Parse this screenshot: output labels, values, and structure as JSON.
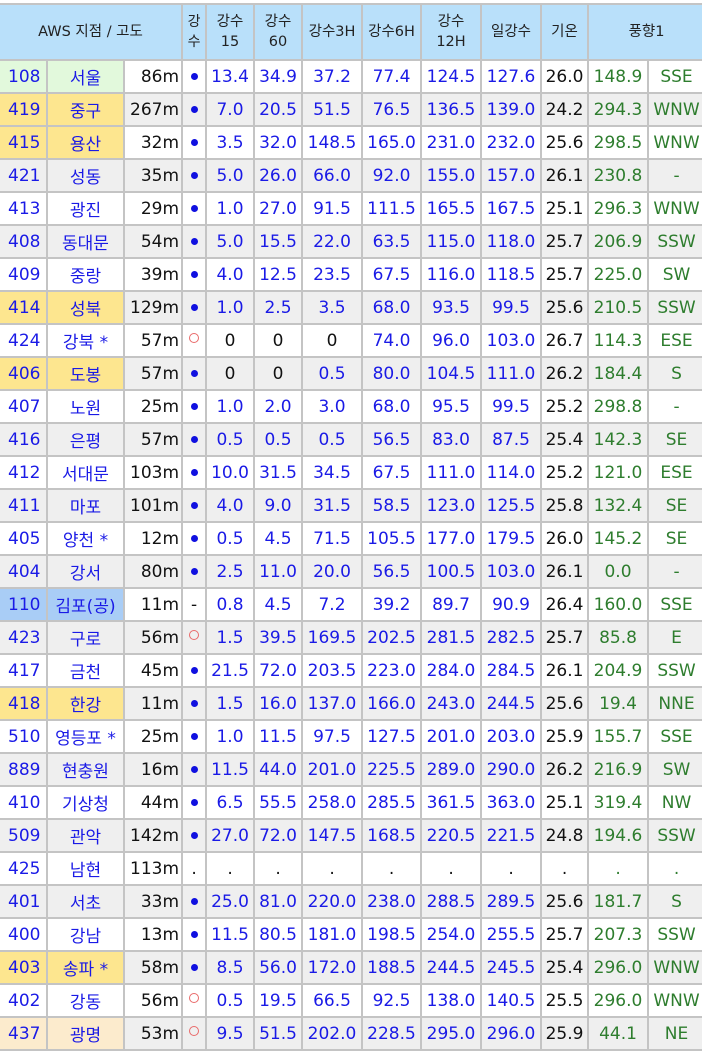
{
  "header": {
    "station": "AWS 지점 / 고도",
    "rain": "강수",
    "rain15": "강수 15",
    "rain60": "강수 60",
    "rain3h": "강수3H",
    "rain6h": "강수6H",
    "rain12h": "강수 12H",
    "daily": "일강수",
    "temp": "기온",
    "wind": "풍향1"
  },
  "colors": {
    "yellow": "#fde68f",
    "green": "#e2f9dc",
    "blue": "#a9cdf6",
    "peach": "#fcebcd",
    "value": "#1a1ae6",
    "wind": "#2e7d2e"
  },
  "rows": [
    {
      "id": "108",
      "name": "서울",
      "alt": "86m",
      "rain": "dot",
      "r15": "13.4",
      "r60": "34.9",
      "r3": "37.2",
      "r6": "77.4",
      "r12": "124.5",
      "day": "127.6",
      "temp": "26.0",
      "deg": "148.9",
      "dir": "SSE",
      "hl": "green"
    },
    {
      "id": "419",
      "name": "중구",
      "alt": "267m",
      "rain": "dot",
      "r15": "7.0",
      "r60": "20.5",
      "r3": "51.5",
      "r6": "76.5",
      "r12": "136.5",
      "day": "139.0",
      "temp": "24.2",
      "deg": "294.3",
      "dir": "WNW",
      "hl": "yellow"
    },
    {
      "id": "415",
      "name": "용산",
      "alt": "32m",
      "rain": "dot",
      "r15": "3.5",
      "r60": "32.0",
      "r3": "148.5",
      "r6": "165.0",
      "r12": "231.0",
      "day": "232.0",
      "temp": "25.6",
      "deg": "298.5",
      "dir": "WNW",
      "hl": "yellow"
    },
    {
      "id": "421",
      "name": "성동",
      "alt": "35m",
      "rain": "dot",
      "r15": "5.0",
      "r60": "26.0",
      "r3": "66.0",
      "r6": "92.0",
      "r12": "155.0",
      "day": "157.0",
      "temp": "26.1",
      "deg": "230.8",
      "dir": "-",
      "hl": ""
    },
    {
      "id": "413",
      "name": "광진",
      "alt": "29m",
      "rain": "dot",
      "r15": "1.0",
      "r60": "27.0",
      "r3": "91.5",
      "r6": "111.5",
      "r12": "165.5",
      "day": "167.5",
      "temp": "25.1",
      "deg": "296.3",
      "dir": "WNW",
      "hl": ""
    },
    {
      "id": "408",
      "name": "동대문",
      "alt": "54m",
      "rain": "dot",
      "r15": "5.0",
      "r60": "15.5",
      "r3": "22.0",
      "r6": "63.5",
      "r12": "115.0",
      "day": "118.0",
      "temp": "25.7",
      "deg": "206.9",
      "dir": "SSW",
      "hl": ""
    },
    {
      "id": "409",
      "name": "중랑",
      "alt": "39m",
      "rain": "dot",
      "r15": "4.0",
      "r60": "12.5",
      "r3": "23.5",
      "r6": "67.5",
      "r12": "116.0",
      "day": "118.5",
      "temp": "25.7",
      "deg": "225.0",
      "dir": "SW",
      "hl": ""
    },
    {
      "id": "414",
      "name": "성북",
      "alt": "129m",
      "rain": "dot",
      "r15": "1.0",
      "r60": "2.5",
      "r3": "3.5",
      "r6": "68.0",
      "r12": "93.5",
      "day": "99.5",
      "temp": "25.6",
      "deg": "210.5",
      "dir": "SSW",
      "hl": "yellow"
    },
    {
      "id": "424",
      "name": "강북 *",
      "alt": "57m",
      "rain": "ring",
      "r15": "0",
      "r60": "0",
      "r3": "0",
      "r6": "74.0",
      "r12": "96.0",
      "day": "103.0",
      "temp": "26.7",
      "deg": "114.3",
      "dir": "ESE",
      "hl": ""
    },
    {
      "id": "406",
      "name": "도봉",
      "alt": "57m",
      "rain": "dot",
      "r15": "0",
      "r60": "0",
      "r3": "0.5",
      "r6": "80.0",
      "r12": "104.5",
      "day": "111.0",
      "temp": "26.2",
      "deg": "184.4",
      "dir": "S",
      "hl": "yellow"
    },
    {
      "id": "407",
      "name": "노원",
      "alt": "25m",
      "rain": "dot",
      "r15": "1.0",
      "r60": "2.0",
      "r3": "3.0",
      "r6": "68.0",
      "r12": "95.5",
      "day": "99.5",
      "temp": "25.2",
      "deg": "298.8",
      "dir": "-",
      "hl": ""
    },
    {
      "id": "416",
      "name": "은평",
      "alt": "57m",
      "rain": "dot",
      "r15": "0.5",
      "r60": "0.5",
      "r3": "0.5",
      "r6": "56.5",
      "r12": "83.0",
      "day": "87.5",
      "temp": "25.4",
      "deg": "142.3",
      "dir": "SE",
      "hl": ""
    },
    {
      "id": "412",
      "name": "서대문",
      "alt": "103m",
      "rain": "dot",
      "r15": "10.0",
      "r60": "31.5",
      "r3": "34.5",
      "r6": "67.5",
      "r12": "111.0",
      "day": "114.0",
      "temp": "25.2",
      "deg": "121.0",
      "dir": "ESE",
      "hl": ""
    },
    {
      "id": "411",
      "name": "마포",
      "alt": "101m",
      "rain": "dot",
      "r15": "4.0",
      "r60": "9.0",
      "r3": "31.5",
      "r6": "58.5",
      "r12": "123.0",
      "day": "125.5",
      "temp": "25.8",
      "deg": "132.4",
      "dir": "SE",
      "hl": ""
    },
    {
      "id": "405",
      "name": "양천 *",
      "alt": "12m",
      "rain": "dot",
      "r15": "0.5",
      "r60": "4.5",
      "r3": "71.5",
      "r6": "105.5",
      "r12": "177.0",
      "day": "179.5",
      "temp": "26.0",
      "deg": "145.2",
      "dir": "SE",
      "hl": ""
    },
    {
      "id": "404",
      "name": "강서",
      "alt": "80m",
      "rain": "dot",
      "r15": "2.5",
      "r60": "11.0",
      "r3": "20.0",
      "r6": "56.5",
      "r12": "100.5",
      "day": "103.0",
      "temp": "26.1",
      "deg": "0.0",
      "dir": "-",
      "hl": ""
    },
    {
      "id": "110",
      "name": "김포(공)",
      "alt": "11m",
      "rain": "-",
      "r15": "0.8",
      "r60": "4.5",
      "r3": "7.2",
      "r6": "39.2",
      "r12": "89.7",
      "day": "90.9",
      "temp": "26.4",
      "deg": "160.0",
      "dir": "SSE",
      "hl": "blue"
    },
    {
      "id": "423",
      "name": "구로",
      "alt": "56m",
      "rain": "ring",
      "r15": "1.5",
      "r60": "39.5",
      "r3": "169.5",
      "r6": "202.5",
      "r12": "281.5",
      "day": "282.5",
      "temp": "25.7",
      "deg": "85.8",
      "dir": "E",
      "hl": ""
    },
    {
      "id": "417",
      "name": "금천",
      "alt": "45m",
      "rain": "dot",
      "r15": "21.5",
      "r60": "72.0",
      "r3": "203.5",
      "r6": "223.0",
      "r12": "284.0",
      "day": "284.5",
      "temp": "26.1",
      "deg": "204.9",
      "dir": "SSW",
      "hl": ""
    },
    {
      "id": "418",
      "name": "한강",
      "alt": "11m",
      "rain": "dot",
      "r15": "1.5",
      "r60": "16.0",
      "r3": "137.0",
      "r6": "166.0",
      "r12": "243.0",
      "day": "244.5",
      "temp": "25.6",
      "deg": "19.4",
      "dir": "NNE",
      "hl": "yellow"
    },
    {
      "id": "510",
      "name": "영등포 *",
      "alt": "25m",
      "rain": "dot",
      "r15": "1.0",
      "r60": "11.5",
      "r3": "97.5",
      "r6": "127.5",
      "r12": "201.0",
      "day": "203.0",
      "temp": "25.9",
      "deg": "155.7",
      "dir": "SSE",
      "hl": ""
    },
    {
      "id": "889",
      "name": "현충원",
      "alt": "16m",
      "rain": "dot",
      "r15": "11.5",
      "r60": "44.0",
      "r3": "201.0",
      "r6": "225.5",
      "r12": "289.0",
      "day": "290.0",
      "temp": "26.2",
      "deg": "216.9",
      "dir": "SW",
      "hl": ""
    },
    {
      "id": "410",
      "name": "기상청",
      "alt": "44m",
      "rain": "dot",
      "r15": "6.5",
      "r60": "55.5",
      "r3": "258.0",
      "r6": "285.5",
      "r12": "361.5",
      "day": "363.0",
      "temp": "25.1",
      "deg": "319.4",
      "dir": "NW",
      "hl": ""
    },
    {
      "id": "509",
      "name": "관악",
      "alt": "142m",
      "rain": "dot",
      "r15": "27.0",
      "r60": "72.0",
      "r3": "147.5",
      "r6": "168.5",
      "r12": "220.5",
      "day": "221.5",
      "temp": "24.8",
      "deg": "194.6",
      "dir": "SSW",
      "hl": ""
    },
    {
      "id": "425",
      "name": "남현",
      "alt": "113m",
      "rain": ".",
      "r15": ".",
      "r60": ".",
      "r3": ".",
      "r6": ".",
      "r12": ".",
      "day": ".",
      "temp": ".",
      "deg": ".",
      "dir": ".",
      "hl": ""
    },
    {
      "id": "401",
      "name": "서초",
      "alt": "33m",
      "rain": "dot",
      "r15": "25.0",
      "r60": "81.0",
      "r3": "220.0",
      "r6": "238.0",
      "r12": "288.5",
      "day": "289.5",
      "temp": "25.6",
      "deg": "181.7",
      "dir": "S",
      "hl": ""
    },
    {
      "id": "400",
      "name": "강남",
      "alt": "13m",
      "rain": "dot",
      "r15": "11.5",
      "r60": "80.5",
      "r3": "181.0",
      "r6": "198.5",
      "r12": "254.0",
      "day": "255.5",
      "temp": "25.7",
      "deg": "207.3",
      "dir": "SSW",
      "hl": ""
    },
    {
      "id": "403",
      "name": "송파 *",
      "alt": "58m",
      "rain": "dot",
      "r15": "8.5",
      "r60": "56.0",
      "r3": "172.0",
      "r6": "188.5",
      "r12": "244.5",
      "day": "245.5",
      "temp": "25.4",
      "deg": "296.0",
      "dir": "WNW",
      "hl": "yellow"
    },
    {
      "id": "402",
      "name": "강동",
      "alt": "56m",
      "rain": "ring",
      "r15": "0.5",
      "r60": "19.5",
      "r3": "66.5",
      "r6": "92.5",
      "r12": "138.0",
      "day": "140.5",
      "temp": "25.5",
      "deg": "296.0",
      "dir": "WNW",
      "hl": ""
    },
    {
      "id": "437",
      "name": "광명",
      "alt": "53m",
      "rain": "ring",
      "r15": "9.5",
      "r60": "51.5",
      "r3": "202.0",
      "r6": "228.5",
      "r12": "295.0",
      "day": "296.0",
      "temp": "25.9",
      "deg": "44.1",
      "dir": "NE",
      "hl": "peach"
    }
  ]
}
